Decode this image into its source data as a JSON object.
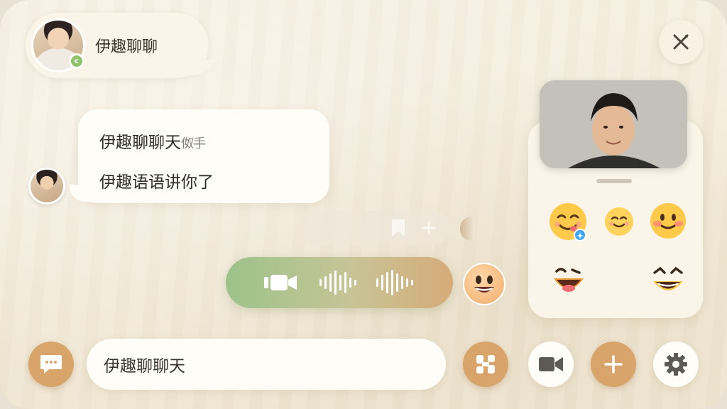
{
  "header": {
    "chat_title": "伊趣聊聊",
    "status_badge": "c"
  },
  "messages": {
    "incoming": {
      "line1": "伊趣聊聊天",
      "line1_fade": "伮手",
      "line2": "伊趣语语讲你了"
    }
  },
  "composer": {
    "input_value": "伊趣聊聊天",
    "input_placeholder": ""
  },
  "icons": {
    "close": "close-icon",
    "chat": "chat-bubble-icon",
    "camera": "video-camera-icon",
    "apps": "apps-grid-icon",
    "settings": "gear-icon",
    "add": "plus-icon"
  },
  "colors": {
    "accent": "#d9a469",
    "voice_start": "#9cc38a",
    "voice_end": "#d6ab78",
    "background": "#f3ebdc"
  }
}
